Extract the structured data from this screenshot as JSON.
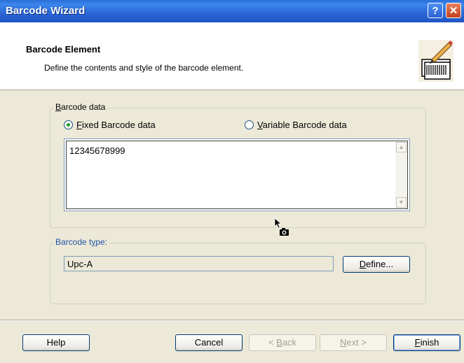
{
  "window": {
    "title": "Barcode Wizard",
    "help_glyph": "?",
    "close_glyph": "✕"
  },
  "header": {
    "title": "Barcode Element",
    "subtitle": "Define the contents and style of the barcode element."
  },
  "barcode_data_group": {
    "label_underline": "B",
    "label_rest": "arcode data",
    "fixed_option": {
      "underline": "F",
      "rest": "ixed Barcode data",
      "selected": true
    },
    "variable_option": {
      "underline": "V",
      "rest": "ariable Barcode data",
      "selected": false
    },
    "value": "12345678999"
  },
  "barcode_type_group": {
    "label_prefix": "Barcode t",
    "label_underline": "y",
    "label_suffix": "pe:",
    "value": "Upc-A",
    "define_underline": "D",
    "define_rest": "efine..."
  },
  "footer": {
    "help": "Help",
    "cancel": "Cancel",
    "back_prefix": "< ",
    "back_underline": "B",
    "back_rest": "ack",
    "next_underline": "N",
    "next_rest": "ext >",
    "finish_underline": "F",
    "finish_rest": "inish"
  }
}
